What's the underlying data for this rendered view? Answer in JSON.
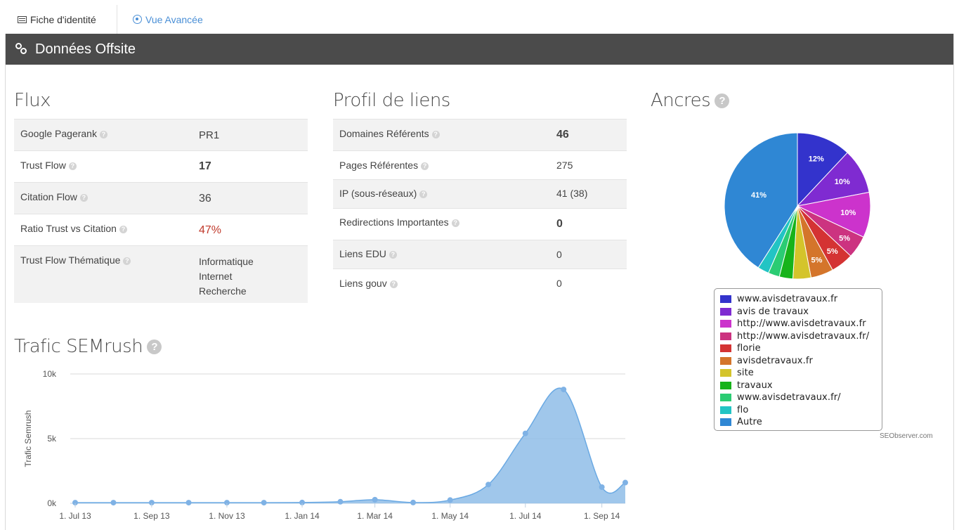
{
  "tabs": [
    {
      "label": "Fiche d'identité"
    },
    {
      "label": "Vue Avancée"
    }
  ],
  "panel": {
    "title": "Données Offsite"
  },
  "flux": {
    "title": "Flux",
    "rows": [
      {
        "label": "Google Pagerank",
        "value": "PR1"
      },
      {
        "label": "Trust Flow",
        "value": "17"
      },
      {
        "label": "Citation Flow",
        "value": "36"
      },
      {
        "label": "Ratio Trust vs Citation",
        "value": "47%"
      },
      {
        "label": "Trust Flow Thématique",
        "value": "Informatique\nInternet\nRecherche"
      }
    ]
  },
  "profil": {
    "title": "Profil de liens",
    "rows": [
      {
        "label": "Domaines Référents",
        "value": "46"
      },
      {
        "label": "Pages Référentes",
        "value": "275"
      },
      {
        "label": "IP (sous-réseaux)",
        "value": "41 (38)"
      },
      {
        "label": "Redirections Importantes",
        "value": "0"
      },
      {
        "label": "Liens EDU",
        "value": "0"
      },
      {
        "label": "Liens gouv",
        "value": "0"
      }
    ]
  },
  "ancres": {
    "title": "Ancres",
    "credit": "SEObserver.com"
  },
  "trafic": {
    "title": "Trafic SEMrush"
  },
  "chart_data": [
    {
      "type": "pie",
      "title": "Ancres",
      "legend_position": "bottom",
      "slices": [
        {
          "name": "www.avisdetravaux.fr",
          "value": 12,
          "label": "12%",
          "color": "#3333cc"
        },
        {
          "name": "avis de travaux",
          "value": 10,
          "label": "10%",
          "color": "#7f2bd1"
        },
        {
          "name": "http://www.avisdetravaux.fr",
          "value": 10,
          "label": "10%",
          "color": "#cc33cc"
        },
        {
          "name": "http://www.avisdetravaux.fr/",
          "value": 5,
          "label": "5%",
          "color": "#cc3380"
        },
        {
          "name": "florie",
          "value": 5,
          "label": "5%",
          "color": "#d43333"
        },
        {
          "name": "avisdetravaux.fr",
          "value": 5,
          "label": "5%",
          "color": "#d4752b"
        },
        {
          "name": "site",
          "value": 4,
          "label": "",
          "color": "#d4c42b"
        },
        {
          "name": "travaux",
          "value": 3,
          "label": "",
          "color": "#17b31a"
        },
        {
          "name": "www.avisdetravaux.fr/",
          "value": 2.5,
          "label": "",
          "color": "#2bcc73"
        },
        {
          "name": "flo",
          "value": 2.5,
          "label": "",
          "color": "#22c4c4"
        },
        {
          "name": "Autre",
          "value": 41,
          "label": "41%",
          "color": "#2f87d4"
        }
      ]
    },
    {
      "type": "area",
      "title": "Trafic SEMrush",
      "ylabel": "Trafic Semrush",
      "xlabel": "",
      "ylim": [
        0,
        10000
      ],
      "yticks": [
        {
          "v": 0,
          "label": "0k"
        },
        {
          "v": 5000,
          "label": "5k"
        },
        {
          "v": 10000,
          "label": "10k"
        }
      ],
      "xticks": [
        "1. Jul 13",
        "1. Sep 13",
        "1. Nov 13",
        "1. Jan 14",
        "1. Mar 14",
        "1. May 14",
        "1. Jul 14",
        "1. Sep 14"
      ],
      "grid": true,
      "color": "#8fbde8",
      "series": [
        {
          "x": [
            "2013-07-01",
            "2013-08-01",
            "2013-09-01",
            "2013-10-01",
            "2013-11-01",
            "2013-12-01",
            "2014-01-01",
            "2014-02-01",
            "2014-03-01",
            "2014-04-01",
            "2014-05-01",
            "2014-06-01",
            "2014-07-01",
            "2014-08-01",
            "2014-09-01",
            "2014-09-20"
          ],
          "values": [
            50,
            50,
            50,
            50,
            50,
            50,
            60,
            120,
            280,
            60,
            250,
            1450,
            5400,
            8800,
            1250,
            1600
          ]
        }
      ]
    }
  ]
}
